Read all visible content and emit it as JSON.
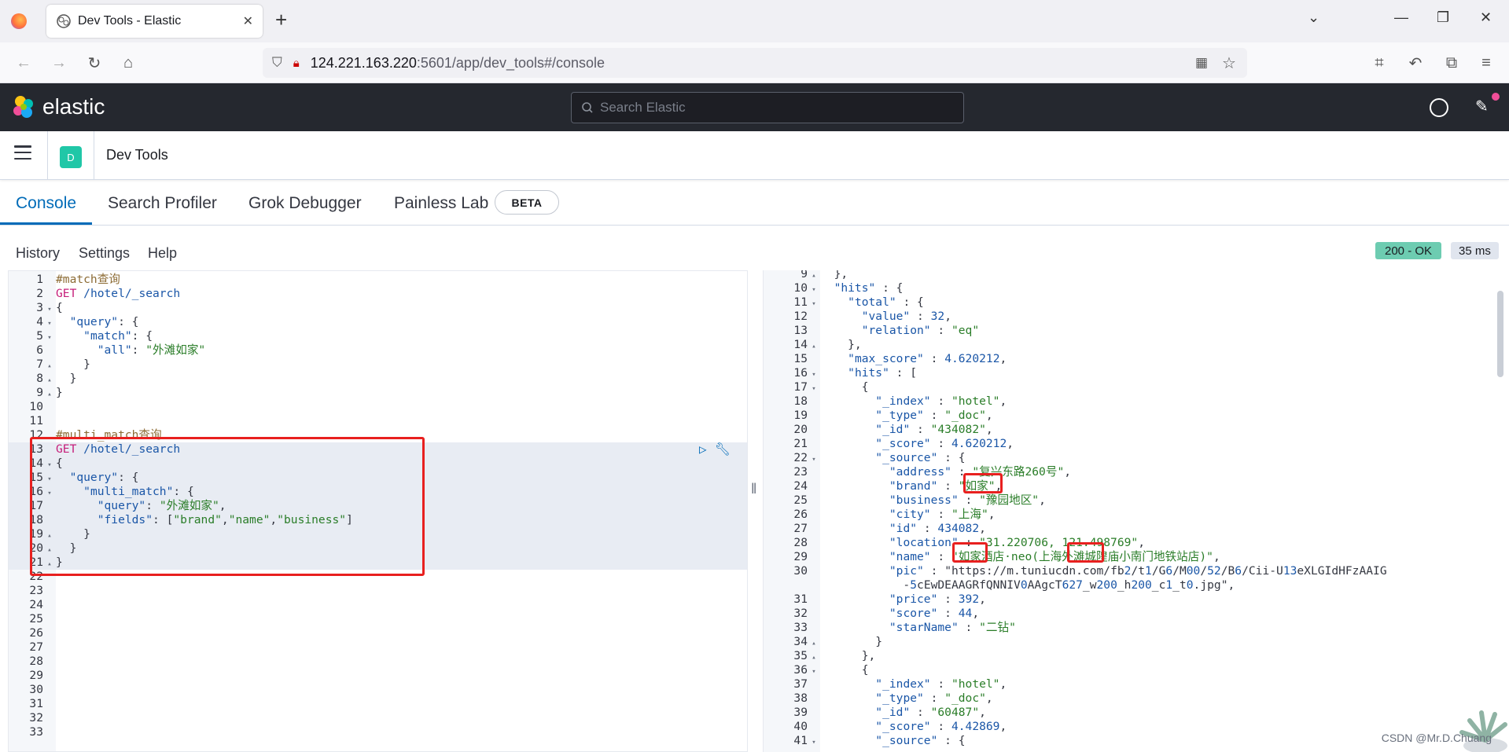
{
  "browser": {
    "tab_title": "Dev Tools - Elastic",
    "url_host": "124.221.163.220",
    "url_path": ":5601/app/dev_tools#/console"
  },
  "header": {
    "brand": "elastic",
    "search_placeholder": "Search Elastic"
  },
  "app": {
    "avatar_letter": "D",
    "title": "Dev Tools"
  },
  "tabs": [
    {
      "label": "Console",
      "active": true
    },
    {
      "label": "Search Profiler"
    },
    {
      "label": "Grok Debugger"
    },
    {
      "label": "Painless Lab"
    }
  ],
  "beta_badge": "BETA",
  "console_menu": {
    "history": "History",
    "settings": "Settings",
    "help": "Help"
  },
  "response_status": "200 - OK",
  "response_time": "35 ms",
  "request_lines": [
    "#match查询",
    "GET /hotel/_search",
    "{",
    "  \"query\": {",
    "    \"match\": {",
    "      \"all\": \"外滩如家\"",
    "    }",
    "  }",
    "}",
    "",
    "",
    "#multi_match查询",
    "GET /hotel/_search",
    "{",
    "  \"query\": {",
    "    \"multi_match\": {",
    "      \"query\": \"外滩如家\",",
    "      \"fields\": [\"brand\",\"name\",\"business\"]",
    "    }",
    "  }",
    "}",
    "",
    "",
    "",
    "",
    "",
    "",
    "",
    "",
    "",
    "",
    "",
    ""
  ],
  "response_lines": [
    {
      "n": "9",
      "text": "  },"
    },
    {
      "n": "10",
      "text": "  \"hits\" : {"
    },
    {
      "n": "11",
      "text": "    \"total\" : {"
    },
    {
      "n": "12",
      "text": "      \"value\" : 32,"
    },
    {
      "n": "13",
      "text": "      \"relation\" : \"eq\""
    },
    {
      "n": "14",
      "text": "    },"
    },
    {
      "n": "15",
      "text": "    \"max_score\" : 4.620212,"
    },
    {
      "n": "16",
      "text": "    \"hits\" : ["
    },
    {
      "n": "17",
      "text": "      {"
    },
    {
      "n": "18",
      "text": "        \"_index\" : \"hotel\","
    },
    {
      "n": "19",
      "text": "        \"_type\" : \"_doc\","
    },
    {
      "n": "20",
      "text": "        \"_id\" : \"434082\","
    },
    {
      "n": "21",
      "text": "        \"_score\" : 4.620212,"
    },
    {
      "n": "22",
      "text": "        \"_source\" : {"
    },
    {
      "n": "23",
      "text": "          \"address\" : \"复兴东路260号\","
    },
    {
      "n": "24",
      "text": "          \"brand\" : \"如家\","
    },
    {
      "n": "25",
      "text": "          \"business\" : \"豫园地区\","
    },
    {
      "n": "26",
      "text": "          \"city\" : \"上海\","
    },
    {
      "n": "27",
      "text": "          \"id\" : 434082,"
    },
    {
      "n": "28",
      "text": "          \"location\" : \"31.220706, 121.498769\","
    },
    {
      "n": "29",
      "text": "          \"name\" : \"如家酒店·neo(上海外滩城隍庙小南门地铁站店)\","
    },
    {
      "n": "30",
      "text": "          \"pic\" : \"https://m.tuniucdn.com/fb2/t1/G6/M00/52/B6/Cii-U13eXLGIdHFzAAIG"
    },
    {
      "n": "",
      "text": "            -5cEwDEAAGRfQNNIV0AAgcT627_w200_h200_c1_t0.jpg\","
    },
    {
      "n": "31",
      "text": "          \"price\" : 392,"
    },
    {
      "n": "32",
      "text": "          \"score\" : 44,"
    },
    {
      "n": "33",
      "text": "          \"starName\" : \"二钻\""
    },
    {
      "n": "34",
      "text": "        }"
    },
    {
      "n": "35",
      "text": "      },"
    },
    {
      "n": "36",
      "text": "      {"
    },
    {
      "n": "37",
      "text": "        \"_index\" : \"hotel\","
    },
    {
      "n": "38",
      "text": "        \"_type\" : \"_doc\","
    },
    {
      "n": "39",
      "text": "        \"_id\" : \"60487\","
    },
    {
      "n": "40",
      "text": "        \"_score\" : 4.42869,"
    },
    {
      "n": "41",
      "text": "        \"_source\" : {"
    }
  ],
  "watermark": "CSDN @Mr.D.Chuang",
  "colors": {
    "accent": "#006bb8",
    "status_ok": "#6dccb1",
    "highlight_box": "#e8201f",
    "header_bg": "#25282f"
  }
}
